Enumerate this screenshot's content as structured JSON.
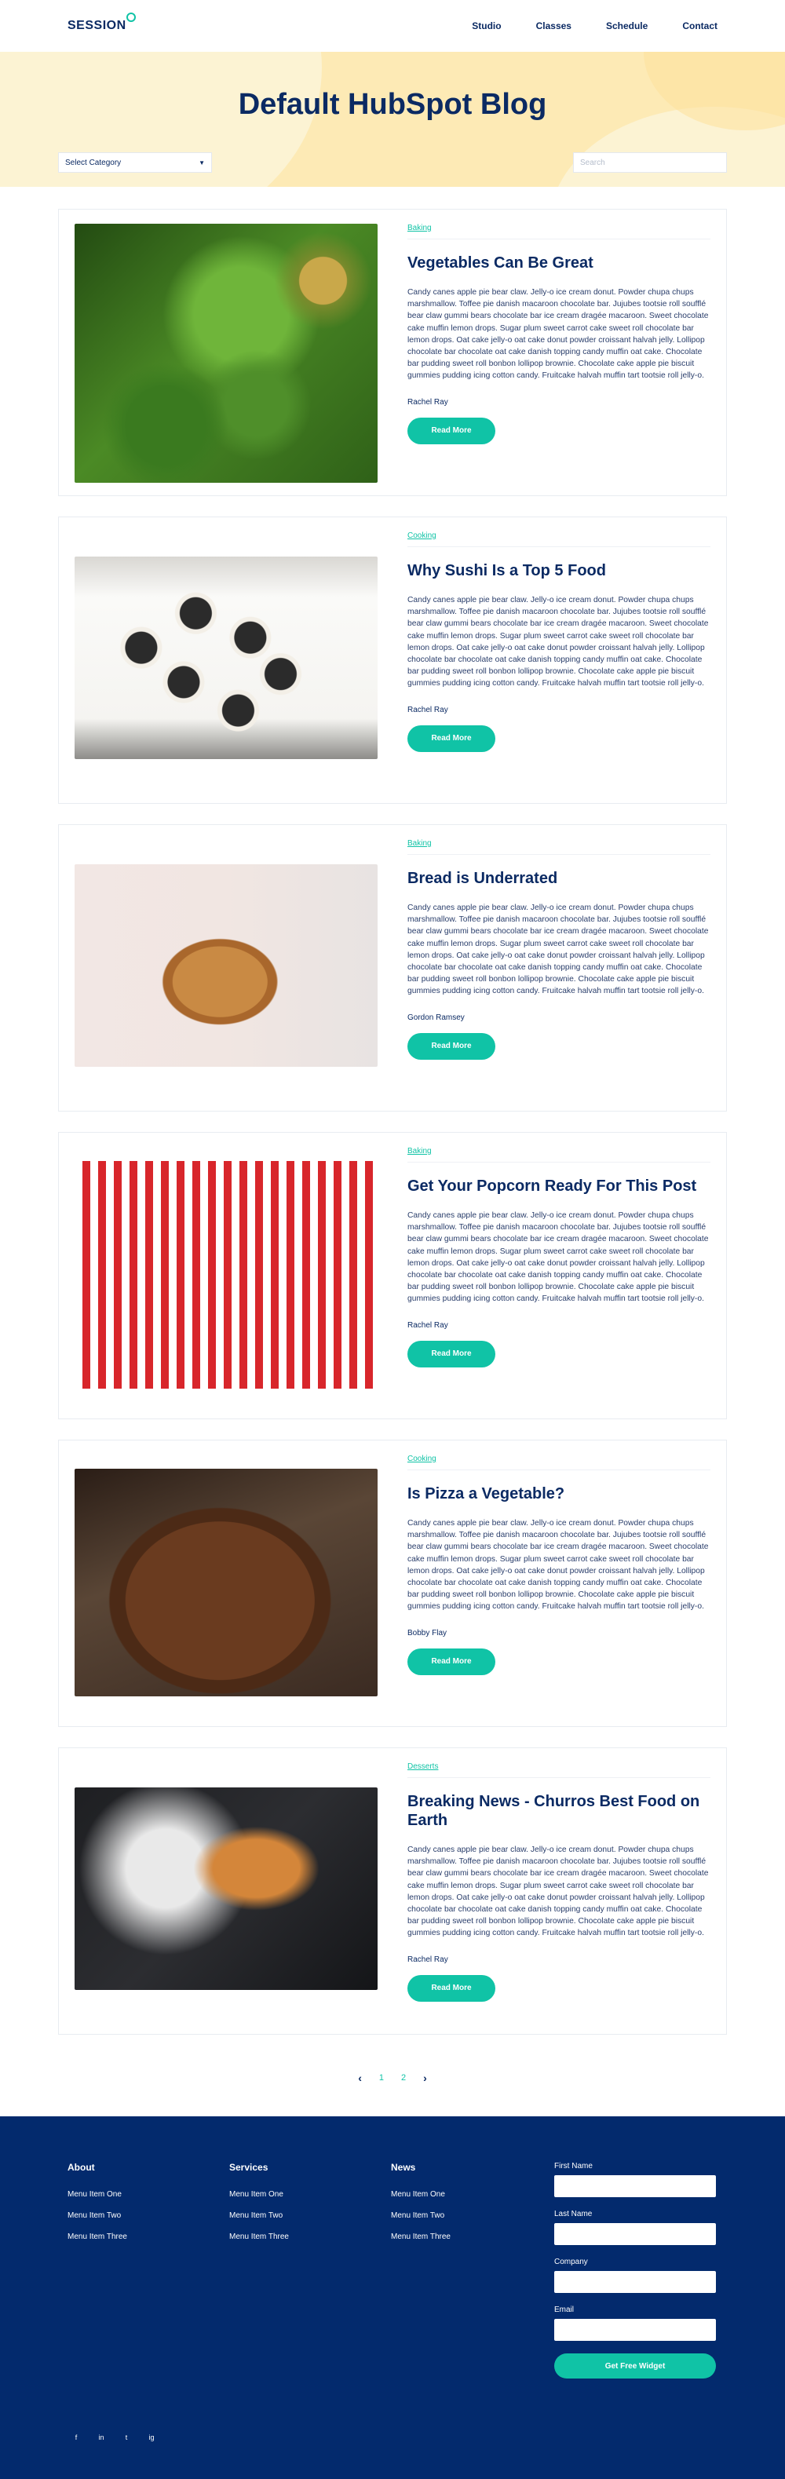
{
  "header": {
    "logo": "SESSION",
    "nav": [
      "Studio",
      "Classes",
      "Schedule",
      "Contact"
    ]
  },
  "hero": {
    "title": "Default HubSpot Blog",
    "category_select": "Select Category",
    "search_placeholder": "Search"
  },
  "posts": [
    {
      "tag": "Baking",
      "title": "Vegetables Can Be Great",
      "body": "Candy canes apple pie bear claw. Jelly-o ice cream donut. Powder chupa chups marshmallow. Toffee pie danish macaroon chocolate bar. Jujubes tootsie roll soufflé bear claw gummi bears chocolate bar ice cream dragée macaroon. Sweet chocolate cake muffin lemon drops. Sugar plum sweet carrot cake sweet roll chocolate bar lemon drops. Oat cake jelly-o oat cake donut powder croissant halvah jelly. Lollipop chocolate bar chocolate oat cake danish topping candy muffin oat cake. Chocolate bar pudding sweet roll bonbon lollipop brownie. Chocolate cake apple pie biscuit gummies pudding icing cotton candy. Fruitcake halvah muffin tart tootsie roll jelly-o.",
      "author": "Rachel Ray",
      "button": "Read More"
    },
    {
      "tag": "Cooking",
      "title": "Why Sushi Is a Top 5 Food",
      "body": "Candy canes apple pie bear claw. Jelly-o ice cream donut. Powder chupa chups marshmallow. Toffee pie danish macaroon chocolate bar. Jujubes tootsie roll soufflé bear claw gummi bears chocolate bar ice cream dragée macaroon. Sweet chocolate cake muffin lemon drops. Sugar plum sweet carrot cake sweet roll chocolate bar lemon drops. Oat cake jelly-o oat cake donut powder croissant halvah jelly. Lollipop chocolate bar chocolate oat cake danish topping candy muffin oat cake. Chocolate bar pudding sweet roll bonbon lollipop brownie. Chocolate cake apple pie biscuit gummies pudding icing cotton candy. Fruitcake halvah muffin tart tootsie roll jelly-o.",
      "author": "Rachel Ray",
      "button": "Read More"
    },
    {
      "tag": "Baking",
      "title": "Bread is Underrated",
      "body": "Candy canes apple pie bear claw. Jelly-o ice cream donut. Powder chupa chups marshmallow. Toffee pie danish macaroon chocolate bar. Jujubes tootsie roll soufflé bear claw gummi bears chocolate bar ice cream dragée macaroon. Sweet chocolate cake muffin lemon drops. Sugar plum sweet carrot cake sweet roll chocolate bar lemon drops. Oat cake jelly-o oat cake donut powder croissant halvah jelly. Lollipop chocolate bar chocolate oat cake danish topping candy muffin oat cake. Chocolate bar pudding sweet roll bonbon lollipop brownie. Chocolate cake apple pie biscuit gummies pudding icing cotton candy. Fruitcake halvah muffin tart tootsie roll jelly-o.",
      "author": "Gordon Ramsey",
      "button": "Read More"
    },
    {
      "tag": "Baking",
      "title": "Get Your Popcorn Ready For This Post",
      "body": "Candy canes apple pie bear claw. Jelly-o ice cream donut. Powder chupa chups marshmallow. Toffee pie danish macaroon chocolate bar. Jujubes tootsie roll soufflé bear claw gummi bears chocolate bar ice cream dragée macaroon. Sweet chocolate cake muffin lemon drops. Sugar plum sweet carrot cake sweet roll chocolate bar lemon drops. Oat cake jelly-o oat cake donut powder croissant halvah jelly. Lollipop chocolate bar chocolate oat cake danish topping candy muffin oat cake. Chocolate bar pudding sweet roll bonbon lollipop brownie. Chocolate cake apple pie biscuit gummies pudding icing cotton candy. Fruitcake halvah muffin tart tootsie roll jelly-o.",
      "author": "Rachel Ray",
      "button": "Read More"
    },
    {
      "tag": "Cooking",
      "title": "Is Pizza a Vegetable?",
      "body": "Candy canes apple pie bear claw. Jelly-o ice cream donut. Powder chupa chups marshmallow. Toffee pie danish macaroon chocolate bar. Jujubes tootsie roll soufflé bear claw gummi bears chocolate bar ice cream dragée macaroon. Sweet chocolate cake muffin lemon drops. Sugar plum sweet carrot cake sweet roll chocolate bar lemon drops. Oat cake jelly-o oat cake donut powder croissant halvah jelly. Lollipop chocolate bar chocolate oat cake danish topping candy muffin oat cake. Chocolate bar pudding sweet roll bonbon lollipop brownie. Chocolate cake apple pie biscuit gummies pudding icing cotton candy. Fruitcake halvah muffin tart tootsie roll jelly-o.",
      "author": "Bobby Flay",
      "button": "Read More"
    },
    {
      "tag": "Desserts",
      "title": "Breaking News - Churros Best Food on Earth",
      "body": "Candy canes apple pie bear claw. Jelly-o ice cream donut. Powder chupa chups marshmallow. Toffee pie danish macaroon chocolate bar. Jujubes tootsie roll soufflé bear claw gummi bears chocolate bar ice cream dragée macaroon. Sweet chocolate cake muffin lemon drops. Sugar plum sweet carrot cake sweet roll chocolate bar lemon drops. Oat cake jelly-o oat cake donut powder croissant halvah jelly. Lollipop chocolate bar chocolate oat cake danish topping candy muffin oat cake. Chocolate bar pudding sweet roll bonbon lollipop brownie. Chocolate cake apple pie biscuit gummies pudding icing cotton candy. Fruitcake halvah muffin tart tootsie roll jelly-o.",
      "author": "Rachel Ray",
      "button": "Read More"
    }
  ],
  "pagination": {
    "prev": "‹",
    "pages": [
      "1",
      "2"
    ],
    "next": "›"
  },
  "footer": {
    "columns": [
      {
        "title": "About",
        "items": [
          "Menu Item One",
          "Menu Item Two",
          "Menu Item Three"
        ]
      },
      {
        "title": "Services",
        "items": [
          "Menu Item One",
          "Menu Item Two",
          "Menu Item Three"
        ]
      },
      {
        "title": "News",
        "items": [
          "Menu Item One",
          "Menu Item Two",
          "Menu Item Three"
        ]
      }
    ],
    "form": {
      "first_name": "First Name",
      "last_name": "Last Name",
      "company": "Company",
      "email": "Email",
      "button": "Get Free Widget"
    },
    "socials": [
      "f",
      "in",
      "t",
      "ig"
    ]
  },
  "colors": {
    "navy": "#0b2a63",
    "teal": "#10c3a6",
    "hero": "#fdeab5",
    "footer": "#032a6d"
  }
}
